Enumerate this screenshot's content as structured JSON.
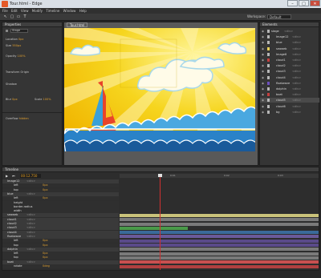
{
  "window": {
    "title": "Tour.html - Edge",
    "min": "–",
    "max": "□",
    "close": "✕"
  },
  "menu": [
    "File",
    "Edit",
    "View",
    "Modify",
    "Timeline",
    "Window",
    "Help"
  ],
  "toolbar": {
    "tools": [
      {
        "name": "selection-tool-icon",
        "glyph": "↖"
      },
      {
        "name": "rectangle-tool-icon",
        "glyph": "▢"
      },
      {
        "name": "rounded-rectangle-tool-icon",
        "glyph": "▭"
      },
      {
        "name": "text-tool-icon",
        "glyph": "T"
      }
    ],
    "workspace_label": "Workspace:",
    "workspace_value": "Default"
  },
  "properties": {
    "tab": "Properties",
    "element_id": "Stage",
    "rows": [
      {
        "label": "Location",
        "value": "0px"
      },
      {
        "label": "Size",
        "value": "550px"
      },
      {
        "label": "Opacity",
        "value": "100%"
      },
      {
        "label": "Transform Origin",
        "value": ""
      },
      {
        "label": "Shadow",
        "value": ""
      },
      {
        "label": "Blur",
        "value": "0px"
      },
      {
        "label": "Scale",
        "value": "100%"
      },
      {
        "label": "Overflow",
        "value": "hidden"
      }
    ]
  },
  "stage": {
    "tab": "Tour.html"
  },
  "elements": {
    "tab": "Elements",
    "items": [
      {
        "label": "stage",
        "type": "<div>",
        "color": "#b7b7b7"
      },
      {
        "label": "Image12",
        "type": "<div>",
        "color": "#b7b7b7"
      },
      {
        "label": "blue",
        "type": "<div>",
        "color": "#b7b7b7"
      },
      {
        "label": "seaweb",
        "type": "<div>",
        "color": "#e8d05a"
      },
      {
        "label": "Image8",
        "type": "<div>",
        "color": "#b7b7b7"
      },
      {
        "label": "cloud1",
        "type": "<div>",
        "color": "#c43e3e"
      },
      {
        "label": "cloud2",
        "type": "<div>",
        "color": "#b7b7b7"
      },
      {
        "label": "cloud3",
        "type": "<div>",
        "color": "#b7b7b7"
      },
      {
        "label": "cloud4",
        "type": "<div>",
        "color": "#b7b7b7"
      },
      {
        "label": "floatwave",
        "type": "<div>",
        "color": "#6c4fbf"
      },
      {
        "label": "dolphin",
        "type": "<div>",
        "color": "#b7b7b7"
      },
      {
        "label": "boat",
        "type": "<div>",
        "color": "#c43e3e"
      },
      {
        "label": "cloud5",
        "type": "<div>",
        "color": "#b7b7b7"
      },
      {
        "label": "cloud6",
        "type": "<div>",
        "color": "#b7b7b7"
      },
      {
        "label": "bg",
        "type": "<div>",
        "color": "#b7b7b7"
      }
    ]
  },
  "timeline": {
    "tab": "Timeline",
    "time": "00:12.750",
    "ruler": [
      "0:01",
      "0:02",
      "0:03"
    ],
    "rows": [
      {
        "label": "Image12",
        "type": "<div>",
        "bar": null
      },
      {
        "label": "left",
        "type": "",
        "bar": null,
        "value": "0px"
      },
      {
        "label": "top",
        "type": "",
        "bar": null,
        "value": "0px"
      },
      {
        "label": "blue",
        "type": "<div>",
        "bar": null
      },
      {
        "label": "left",
        "type": "",
        "bar": null,
        "value": "0px"
      },
      {
        "label": "height",
        "type": "",
        "bar": null,
        "value": ""
      },
      {
        "label": "border-radius",
        "type": "",
        "bar": null,
        "value": ""
      },
      {
        "label": "width",
        "type": "",
        "bar": null,
        "value": ""
      },
      {
        "label": "seaweb",
        "type": "<div>",
        "bar": "#c9c27a"
      },
      {
        "label": "cloud1",
        "type": "<div>",
        "bar": "#7a7a7a"
      },
      {
        "label": "cloud2",
        "type": "<div>",
        "bar": "#7a7a7a"
      },
      {
        "label": "cloud3",
        "type": "<div>",
        "bar": "#4a9a4a"
      },
      {
        "label": "cloud4",
        "type": "<div>",
        "bar": "#3a6a9a"
      },
      {
        "label": "floatwave",
        "type": "<div>",
        "bar": "#6a5a9a"
      },
      {
        "label": "left",
        "type": "",
        "bar": "#5a4a8a",
        "value": "0px"
      },
      {
        "label": "top",
        "type": "",
        "bar": "#5a4a8a",
        "value": "0px"
      },
      {
        "label": "dolphin",
        "type": "<div>",
        "bar": "#7a7a7a"
      },
      {
        "label": "left",
        "type": "",
        "bar": "#7a7a7a",
        "value": "0px"
      },
      {
        "label": "top",
        "type": "",
        "bar": "#7a7a7a",
        "value": "0px"
      },
      {
        "label": "boat",
        "type": "<div>",
        "bar": "#c85050"
      },
      {
        "label": "rotate",
        "type": "",
        "bar": "#b04040",
        "value": "0deg"
      }
    ]
  },
  "colors": {
    "accent": "#e8a020",
    "playhead": "#d03030"
  }
}
